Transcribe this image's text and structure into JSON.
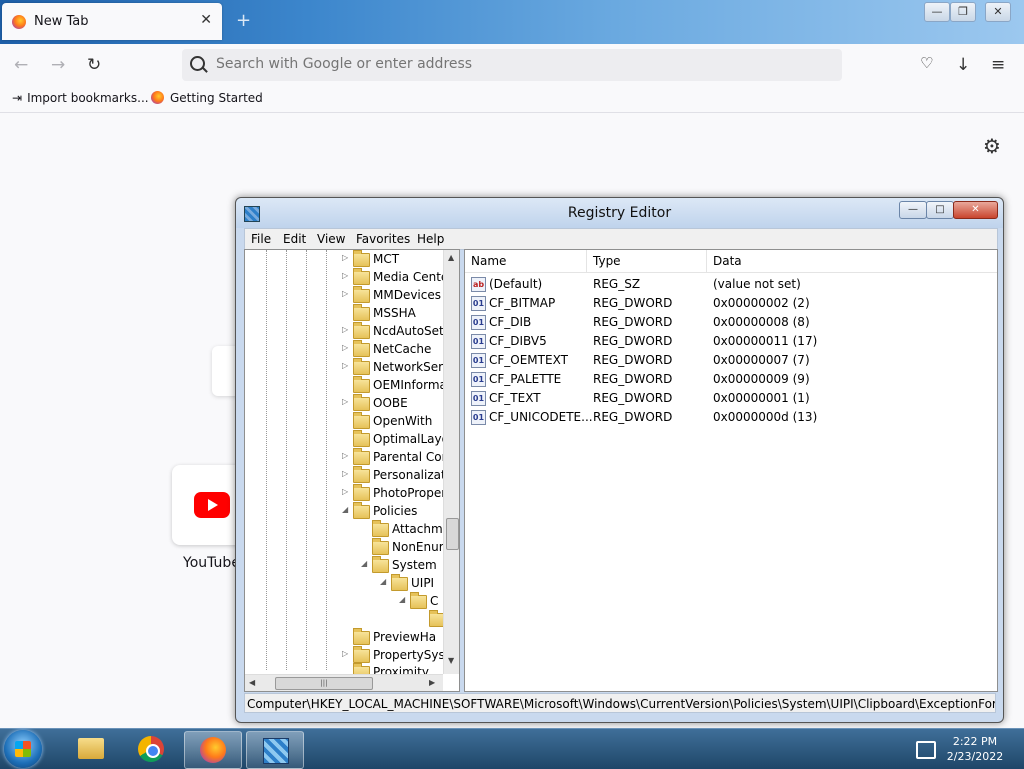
{
  "browser": {
    "tab_title": "New Tab",
    "tab_close": "✕",
    "new_tab": "+",
    "window_controls": {
      "minimize": "—",
      "restore": "❐",
      "close": "✕"
    },
    "nav": {
      "back": "←",
      "forward": "→",
      "reload": "↻"
    },
    "url_placeholder": "Search with Google or enter address",
    "toolbar_icons": {
      "pocket": "pocket-icon",
      "downloads": "↓",
      "menu": "≡"
    },
    "bookmarks": [
      {
        "label": "Import bookmarks...",
        "icon": "import-icon"
      },
      {
        "label": "Getting Started",
        "icon": "firefox-icon"
      }
    ],
    "settings_icon": "⚙",
    "shortcut_tile": {
      "label": "YouTube",
      "icon": "youtube-icon"
    }
  },
  "regedit": {
    "title": "Registry Editor",
    "window_controls": {
      "minimize": "—",
      "maximize": "□",
      "close": "✕"
    },
    "menu": [
      "File",
      "Edit",
      "View",
      "Favorites",
      "Help"
    ],
    "tree": [
      {
        "label": "MCT",
        "expander": "▷"
      },
      {
        "label": "Media Cente",
        "expander": "▷"
      },
      {
        "label": "MMDevices",
        "expander": "▷"
      },
      {
        "label": "MSSHA",
        "expander": ""
      },
      {
        "label": "NcdAutoSet",
        "expander": "▷"
      },
      {
        "label": "NetCache",
        "expander": "▷"
      },
      {
        "label": "NetworkServ",
        "expander": "▷"
      },
      {
        "label": "OEMInforma",
        "expander": ""
      },
      {
        "label": "OOBE",
        "expander": "▷"
      },
      {
        "label": "OpenWith",
        "expander": ""
      },
      {
        "label": "OptimalLayo",
        "expander": ""
      },
      {
        "label": "Parental Cor",
        "expander": "▷"
      },
      {
        "label": "Personalizati",
        "expander": "▷"
      },
      {
        "label": "PhotoProper",
        "expander": "▷"
      },
      {
        "label": "Policies",
        "expander": "◢"
      },
      {
        "label": "Attachm",
        "expander": ""
      },
      {
        "label": "NonEnur",
        "expander": ""
      },
      {
        "label": "System",
        "expander": "◢"
      },
      {
        "label": "UIPI",
        "expander": "◢"
      },
      {
        "label": "C",
        "expander": "◢"
      },
      {
        "label": "",
        "expander": ""
      },
      {
        "label": "PreviewHa",
        "expander": ""
      },
      {
        "label": "PropertySyst",
        "expander": "▷"
      },
      {
        "label": "Proximity",
        "expander": ""
      }
    ],
    "columns": [
      "Name",
      "Type",
      "Data"
    ],
    "values": [
      {
        "icon": "ab",
        "name": "(Default)",
        "type": "REG_SZ",
        "data": "(value not set)"
      },
      {
        "icon": "01",
        "name": "CF_BITMAP",
        "type": "REG_DWORD",
        "data": "0x00000002 (2)"
      },
      {
        "icon": "01",
        "name": "CF_DIB",
        "type": "REG_DWORD",
        "data": "0x00000008 (8)"
      },
      {
        "icon": "01",
        "name": "CF_DIBV5",
        "type": "REG_DWORD",
        "data": "0x00000011 (17)"
      },
      {
        "icon": "01",
        "name": "CF_OEMTEXT",
        "type": "REG_DWORD",
        "data": "0x00000007 (7)"
      },
      {
        "icon": "01",
        "name": "CF_PALETTE",
        "type": "REG_DWORD",
        "data": "0x00000009 (9)"
      },
      {
        "icon": "01",
        "name": "CF_TEXT",
        "type": "REG_DWORD",
        "data": "0x00000001 (1)"
      },
      {
        "icon": "01",
        "name": "CF_UNICODETE...",
        "type": "REG_DWORD",
        "data": "0x0000000d (13)"
      }
    ],
    "status_path": "Computer\\HKEY_LOCAL_MACHINE\\SOFTWARE\\Microsoft\\Windows\\CurrentVersion\\Policies\\System\\UIPI\\Clipboard\\ExceptionFormats",
    "scroll_glyphs": {
      "up": "▲",
      "down": "▼",
      "left": "◀",
      "right": "▶",
      "grip": "|||"
    }
  },
  "taskbar": {
    "clock_time": "2:22 PM",
    "clock_date": "2/23/2022",
    "items": [
      "explorer-icon",
      "chrome-icon",
      "firefox-icon",
      "regedit-icon"
    ]
  }
}
